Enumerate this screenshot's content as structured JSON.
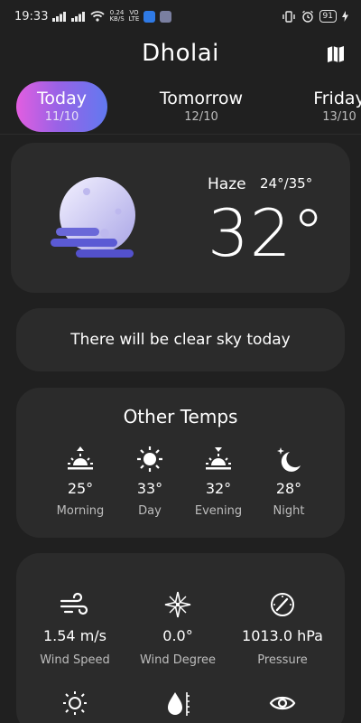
{
  "status_bar": {
    "time": "19:33",
    "data_rate_value": "0.24",
    "data_rate_unit": "KB/S",
    "volte_top": "VO",
    "volte_bottom": "LTE",
    "battery": "91"
  },
  "header": {
    "city": "Dholai"
  },
  "tabs": [
    {
      "label": "Today",
      "date": "11/10"
    },
    {
      "label": "Tomorrow",
      "date": "12/10"
    },
    {
      "label": "Friday",
      "date": "13/10"
    }
  ],
  "current": {
    "condition": "Haze",
    "range": "24°/35°",
    "temp": "32°"
  },
  "description": "There will be clear sky today",
  "other_temps": {
    "title": "Other Temps",
    "items": [
      {
        "value": "25°",
        "label": "Morning",
        "icon": "sunrise-icon"
      },
      {
        "value": "33°",
        "label": "Day",
        "icon": "sun-icon"
      },
      {
        "value": "32°",
        "label": "Evening",
        "icon": "sunset-icon"
      },
      {
        "value": "28°",
        "label": "Night",
        "icon": "moon-stars-icon"
      }
    ]
  },
  "details": [
    {
      "value": "1.54 m/s",
      "label": "Wind Speed",
      "icon": "wind-icon"
    },
    {
      "value": "0.0°",
      "label": "Wind Degree",
      "icon": "compass-rose-icon"
    },
    {
      "value": "1013.0 hPa",
      "label": "Pressure",
      "icon": "gauge-icon"
    }
  ],
  "details_row2_icons": [
    "sun-icon",
    "humidity-drop-icon",
    "eye-icon"
  ],
  "colors": {
    "background": "#202020",
    "card": "#2b2b2b",
    "accent_start": "#e25ee0",
    "accent_end": "#6179f0"
  }
}
